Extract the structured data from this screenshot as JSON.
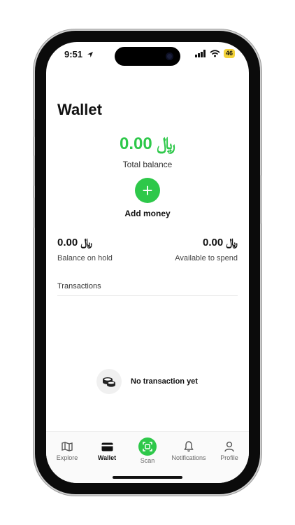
{
  "status": {
    "time": "9:51",
    "battery": "46"
  },
  "page": {
    "title": "Wallet"
  },
  "balance": {
    "total_amount": "0.00 ﷼",
    "total_label": "Total balance",
    "add_money_label": "Add money",
    "on_hold_amount": "0.00 ﷼",
    "on_hold_label": "Balance on hold",
    "available_amount": "0.00 ﷼",
    "available_label": "Available to spend"
  },
  "transactions": {
    "title": "Transactions",
    "empty_text": "No transaction yet",
    "empty_icon": "coins-icon"
  },
  "tabs": [
    {
      "label": "Explore",
      "icon": "map-icon",
      "active": false
    },
    {
      "label": "Wallet",
      "icon": "wallet-icon",
      "active": true
    },
    {
      "label": "Scan",
      "icon": "scan-icon",
      "active": false
    },
    {
      "label": "Notifications",
      "icon": "bell-icon",
      "active": false
    },
    {
      "label": "Profile",
      "icon": "person-icon",
      "active": false
    }
  ],
  "colors": {
    "accent": "#2ec84a",
    "text": "#111111",
    "muted": "#444444"
  }
}
